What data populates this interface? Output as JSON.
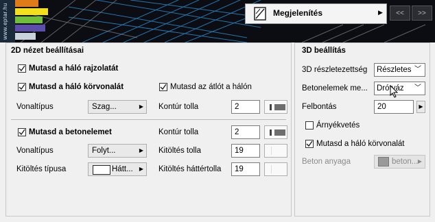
{
  "banner": {
    "logo_text": "www.eptar.hu",
    "menu_label": "Megjelenítés",
    "nav_prev": "<<",
    "nav_next": ">>"
  },
  "panel2d": {
    "title": "2D nézet beállításai",
    "show_mesh_drawing": "Mutasd a háló rajzolatát",
    "show_mesh_outline": "Mutasd a háló körvonalát",
    "show_diagonal": "Mutasd az átlót a hálón",
    "line_type_label": "Vonaltípus",
    "line_type_value_1": "Szag...",
    "outline_pen_label": "Kontúr tolla",
    "outline_pen_value_1": "2",
    "show_concrete": "Mutasd a betonelemet",
    "line_type_value_2": "Folyt...",
    "outline_pen_value_2": "2",
    "fill_pen_label": "Kitöltés tolla",
    "fill_pen_value": "19",
    "fill_type_label": "Kitöltés típusa",
    "fill_type_value": "Hátt...",
    "fill_bg_pen_label": "Kitöltés háttértolla",
    "fill_bg_pen_value": "19"
  },
  "panel3d": {
    "title": "3D beállítás",
    "detail_label": "3D részletezettség",
    "detail_value": "Részletes",
    "concrete_label": "Betonelemek me...",
    "concrete_value": "Drótváz",
    "resolution_label": "Felbontás",
    "resolution_value": "20",
    "shadow_label": "Árnyékvetés",
    "show_outline_label": "Mutasd a háló körvonalát",
    "material_label": "Beton anyaga",
    "material_value": "beton..."
  }
}
